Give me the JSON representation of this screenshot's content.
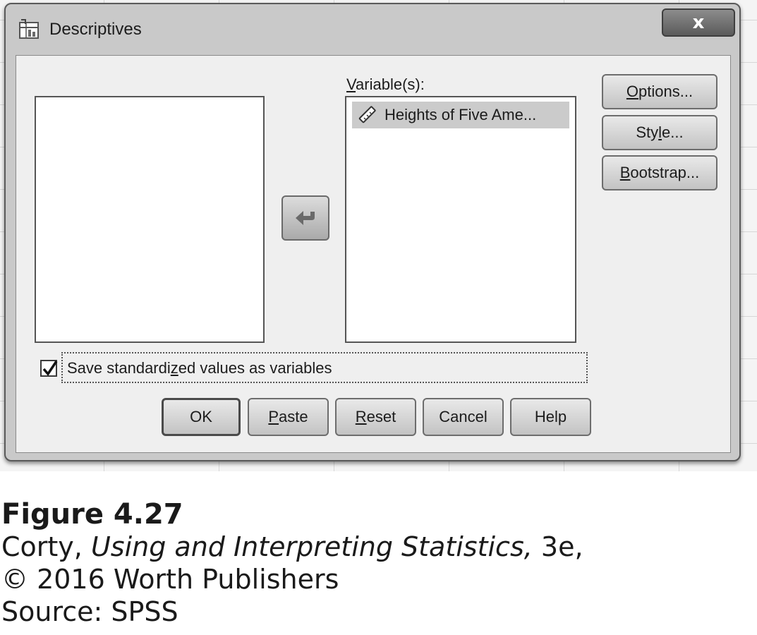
{
  "dialog": {
    "title": "Descriptives",
    "close_label": "x"
  },
  "target_list": {
    "label_prefix": "V",
    "label_rest": "ariable(s):",
    "items": [
      "Heights of Five Ame..."
    ]
  },
  "side_buttons": {
    "options": {
      "u": "O",
      "rest": "ptions..."
    },
    "style": {
      "pre": "Sty",
      "u": "l",
      "rest": "e..."
    },
    "bootstrap": {
      "u": "B",
      "rest": "ootstrap..."
    }
  },
  "checkbox": {
    "checked": true,
    "label_pre": "Save standardi",
    "label_u": "z",
    "label_rest": "ed values as variables"
  },
  "bottom_buttons": {
    "ok": "OK",
    "paste": {
      "u": "P",
      "rest": "aste"
    },
    "reset": {
      "u": "R",
      "rest": "eset"
    },
    "cancel": "Cancel",
    "help": "Help"
  },
  "caption": {
    "figure": "Figure 4.27",
    "line2_pre": "Corty, ",
    "line2_italic": "Using and Interpreting Statistics,",
    "line2_post": " 3e,",
    "line3": "© 2016 Worth Publishers",
    "line4": "Source: SPSS"
  }
}
